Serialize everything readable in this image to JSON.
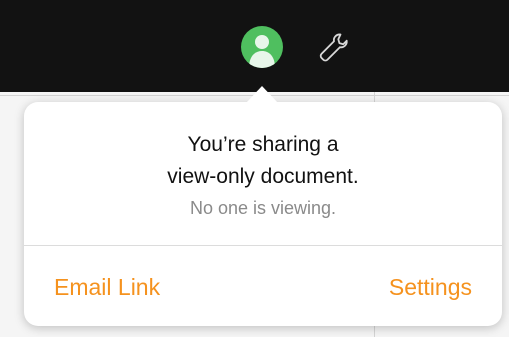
{
  "toolbar": {
    "collaborate_icon": "person-icon",
    "tools_icon": "wrench-icon",
    "background_color": "#121212",
    "collaborate_color": "#4fbf5f"
  },
  "popover": {
    "title_line1": "You’re sharing a",
    "title_line2": "view-only document.",
    "status": "No one is viewing.",
    "actions": {
      "email_link": "Email Link",
      "settings": "Settings"
    },
    "accent_color": "#f5921e"
  }
}
